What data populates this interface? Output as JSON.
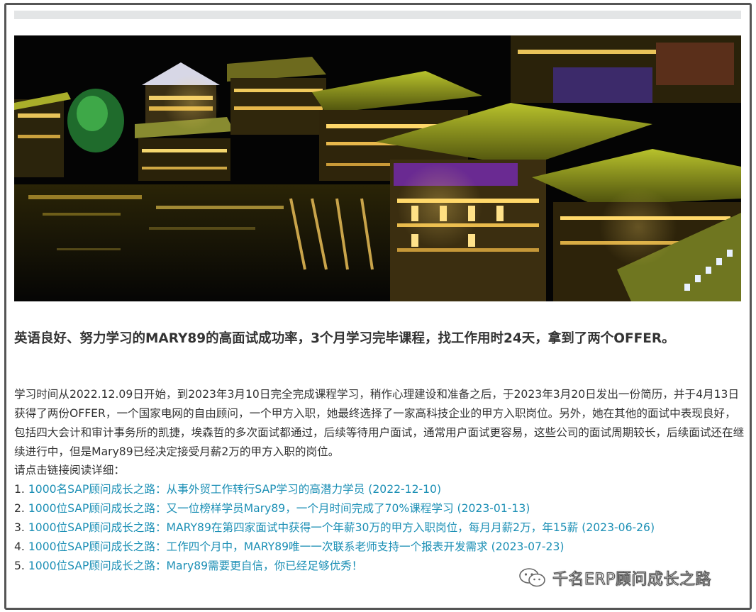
{
  "article": {
    "headline": "英语良好、努力学习的MARY89的高面试成功率，3个月学习完毕课程，找工作用时24天，拿到了两个OFFER。",
    "body": "学习时间从2022.12.09日开始，到2023年3月10日完全完成课程学习，稍作心理建设和准备之后，于2023年3月20日发出一份简历，并于4月13日获得了两份OFFER，一个国家电网的自由顾问，一个甲方入职，她最终选择了一家高科技企业的甲方入职岗位。另外，她在其他的面试中表现良好，包括四大会计和审计事务所的凯捷，埃森哲的多次面试都通过，后续等待用户面试，通常用户面试更容易，这些公司的面试周期较长，后续面试还在继续进行中，但是Mary89已经决定接受月薪2万的甲方入职的岗位。",
    "prompt": "请点击链接阅读详细：",
    "links": [
      {
        "num": "1.",
        "text": "1000名SAP顾问成长之路：从事外贸工作转行SAP学习的高潜力学员 (2022-12-10)"
      },
      {
        "num": "2.",
        "text": "1000位SAP顾问成长之路：又一位榜样学员Mary89，一个月时间完成了70%课程学习 (2023-01-13)"
      },
      {
        "num": "3.",
        "text": "1000位SAP顾问成长之路：MARY89在第四家面试中获得一个年薪30万的甲方入职岗位，每月月薪2万，年15薪 (2023-06-26)"
      },
      {
        "num": "4.",
        "text": "1000位SAP顾问成长之路：工作四个月中，MARY89唯一一次联系老师支持一个报表开发需求 (2023-07-23)"
      },
      {
        "num": "5.",
        "text": "1000位SAP顾问成长之路：Mary89需要更自信，你已经足够优秀！"
      }
    ]
  },
  "watermark": {
    "text": "千名ERP顾问成长之路",
    "icon": "wechat-icon"
  },
  "colors": {
    "link": "#1b8fb5",
    "text": "#333333",
    "border": "#555555"
  }
}
